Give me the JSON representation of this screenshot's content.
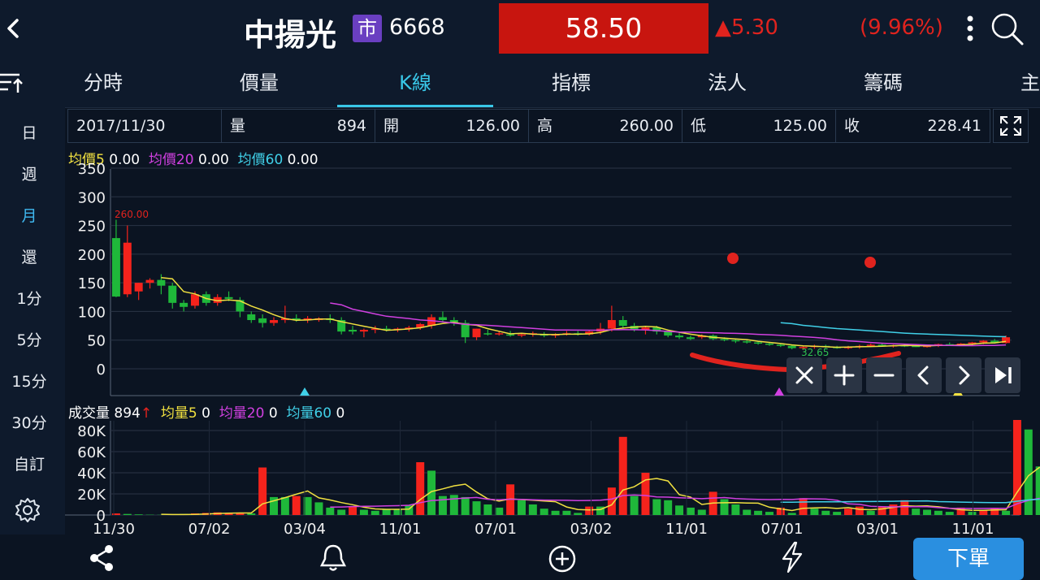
{
  "header": {
    "back_icon": "chevron-left-icon",
    "stock_name": "中揚光",
    "market_badge": "市",
    "stock_code": "6668",
    "price": "58.50",
    "change": "▲5.30",
    "change_pct": "(9.96%)",
    "colors": {
      "up": "#e0231e",
      "price_bg": "#c8150f"
    }
  },
  "tabs": {
    "menu_icon": "sort-icon",
    "items": [
      "分時",
      "價量",
      "K線",
      "指標",
      "法人",
      "籌碼",
      "主"
    ],
    "active": "K線"
  },
  "sidebar": {
    "items": [
      "日",
      "週",
      "月",
      "還",
      "1分",
      "5分",
      "15分",
      "30分",
      "自訂"
    ],
    "active": "月",
    "settings_icon": "gear-icon"
  },
  "infobar": {
    "date": "2017/11/30",
    "volume_label": "量",
    "volume": "894",
    "open_label": "開",
    "open": "126.00",
    "high_label": "高",
    "high": "260.00",
    "low_label": "低",
    "low": "125.00",
    "close_label": "收",
    "close": "228.41"
  },
  "price_legend": {
    "ma5_label": "均價5",
    "ma5": "0.00",
    "ma20_label": "均價20",
    "ma20": "0.00",
    "ma60_label": "均價60",
    "ma60": "0.00"
  },
  "volume_legend": {
    "label": "成交量",
    "value": "894",
    "arrow": "↑",
    "ma5_label": "均量5",
    "ma5": "0",
    "ma20_label": "均量20",
    "ma20": "0",
    "ma60_label": "均量60",
    "ma60": "0"
  },
  "chart_data": {
    "type": "candlestick",
    "price_axis": {
      "ticks": [
        "350",
        "300",
        "250",
        "200",
        "150",
        "100",
        "50",
        "0"
      ],
      "ylim": [
        0,
        350
      ]
    },
    "volume_axis": {
      "ticks": [
        "80K",
        "60K",
        "40K",
        "20K",
        "0"
      ],
      "ylim": [
        0,
        85000
      ]
    },
    "x_labels": [
      "11/30",
      "07/02",
      "03/04",
      "11/01",
      "07/01",
      "03/02",
      "11/01",
      "07/01",
      "03/01",
      "11/01"
    ],
    "annotations": {
      "max_label": "260.00",
      "min_label": "32.65"
    },
    "candles": [
      [
        228,
        260,
        125,
        126
      ],
      [
        130,
        250,
        125,
        220
      ],
      [
        135,
        150,
        120,
        150
      ],
      [
        150,
        158,
        140,
        155
      ],
      [
        155,
        165,
        130,
        145
      ],
      [
        145,
        150,
        105,
        115
      ],
      [
        115,
        120,
        100,
        108
      ],
      [
        110,
        135,
        105,
        130
      ],
      [
        130,
        135,
        110,
        115
      ],
      [
        115,
        130,
        110,
        125
      ],
      [
        125,
        135,
        118,
        122
      ],
      [
        120,
        125,
        90,
        100
      ],
      [
        95,
        100,
        80,
        85
      ],
      [
        88,
        95,
        72,
        80
      ],
      [
        80,
        90,
        75,
        85
      ],
      [
        85,
        110,
        80,
        88
      ],
      [
        88,
        95,
        82,
        85
      ],
      [
        85,
        92,
        80,
        88
      ],
      [
        85,
        90,
        82,
        88
      ],
      [
        88,
        95,
        80,
        85
      ],
      [
        85,
        90,
        60,
        65
      ],
      [
        68,
        75,
        60,
        65
      ],
      [
        65,
        70,
        55,
        68
      ],
      [
        68,
        75,
        62,
        70
      ],
      [
        70,
        75,
        65,
        68
      ],
      [
        68,
        72,
        64,
        70
      ],
      [
        70,
        75,
        65,
        72
      ],
      [
        72,
        80,
        68,
        78
      ],
      [
        75,
        95,
        70,
        90
      ],
      [
        90,
        100,
        82,
        85
      ],
      [
        85,
        90,
        75,
        80
      ],
      [
        80,
        85,
        45,
        55
      ],
      [
        55,
        70,
        50,
        70
      ],
      [
        62,
        68,
        58,
        60
      ],
      [
        62,
        66,
        58,
        62
      ],
      [
        60,
        66,
        56,
        58
      ],
      [
        58,
        62,
        55,
        60
      ],
      [
        60,
        65,
        56,
        62
      ],
      [
        60,
        64,
        55,
        58
      ],
      [
        58,
        62,
        54,
        60
      ],
      [
        60,
        66,
        58,
        62
      ],
      [
        62,
        66,
        58,
        60
      ],
      [
        60,
        68,
        58,
        65
      ],
      [
        65,
        80,
        60,
        70
      ],
      [
        70,
        110,
        65,
        85
      ],
      [
        85,
        92,
        70,
        75
      ],
      [
        75,
        80,
        65,
        68
      ],
      [
        68,
        75,
        60,
        72
      ],
      [
        72,
        75,
        60,
        65
      ],
      [
        65,
        68,
        55,
        58
      ],
      [
        58,
        62,
        52,
        55
      ],
      [
        55,
        58,
        50,
        52
      ],
      [
        55,
        60,
        52,
        58
      ],
      [
        58,
        60,
        50,
        52
      ],
      [
        52,
        55,
        48,
        50
      ],
      [
        50,
        52,
        45,
        48
      ],
      [
        48,
        50,
        44,
        46
      ],
      [
        46,
        48,
        42,
        44
      ],
      [
        44,
        46,
        40,
        42
      ],
      [
        42,
        44,
        38,
        40
      ],
      [
        40,
        42,
        34,
        36
      ],
      [
        36,
        40,
        33,
        38
      ],
      [
        38,
        42,
        35,
        40
      ],
      [
        40,
        42,
        36,
        38
      ],
      [
        38,
        40,
        35,
        36
      ],
      [
        36,
        40,
        34,
        38
      ],
      [
        38,
        42,
        35,
        40
      ],
      [
        40,
        44,
        38,
        42
      ],
      [
        42,
        44,
        39,
        40
      ],
      [
        40,
        42,
        37,
        41
      ],
      [
        41,
        43,
        38,
        40
      ],
      [
        40,
        42,
        38,
        39
      ],
      [
        39,
        41,
        37,
        40
      ],
      [
        40,
        44,
        38,
        43
      ],
      [
        43,
        46,
        40,
        42
      ],
      [
        42,
        45,
        40,
        44
      ],
      [
        44,
        47,
        41,
        46
      ],
      [
        46,
        50,
        43,
        49
      ],
      [
        49,
        52,
        44,
        45
      ],
      [
        45,
        58,
        44,
        55
      ]
    ],
    "volumes": [
      1500,
      1000,
      600,
      300,
      200,
      200,
      1000,
      1500,
      2000,
      2500,
      2000,
      1800,
      1500,
      45000,
      17000,
      17000,
      18000,
      17000,
      12000,
      7000,
      5000,
      8000,
      5000,
      4000,
      5000,
      5000,
      9000,
      50000,
      42000,
      18000,
      19000,
      17000,
      13000,
      10000,
      7000,
      29000,
      14000,
      10000,
      6000,
      4000,
      4000,
      2000,
      8000,
      8000,
      26000,
      74000,
      18000,
      40000,
      15000,
      14000,
      9000,
      7000,
      5000,
      22000,
      15000,
      10000,
      5000,
      4000,
      3000,
      7000,
      2000,
      16000,
      6000,
      4000,
      3000,
      6000,
      8000,
      4000,
      8000,
      10000,
      14000,
      6000,
      5000,
      4000,
      3000,
      7000,
      3000,
      5000,
      6000,
      4000,
      90000,
      81000,
      46000
    ],
    "vol_up": [
      true,
      false,
      false,
      false,
      false,
      false,
      false,
      true,
      true,
      true,
      true,
      true,
      false,
      true,
      false,
      false,
      true,
      false,
      false,
      false,
      false,
      true,
      false,
      false,
      false,
      false,
      false,
      true,
      false,
      false,
      false,
      false,
      false,
      false,
      false,
      true,
      false,
      false,
      false,
      false,
      false,
      false,
      true,
      false,
      true,
      true,
      false,
      true,
      false,
      false,
      false,
      false,
      false,
      true,
      false,
      false,
      false,
      false,
      false,
      true,
      false,
      true,
      false,
      false,
      false,
      true,
      true,
      false,
      true,
      true,
      true,
      false,
      false,
      false,
      false,
      true,
      false,
      true,
      true,
      false,
      true,
      false,
      false
    ],
    "colors": {
      "up": "#f5231c",
      "down": "#1fb83a",
      "ma5": "#f0e040",
      "ma20": "#d040e0",
      "ma60": "#40d0e8"
    }
  },
  "controls": {
    "icons": [
      "close-icon",
      "zoom-in-icon",
      "zoom-out-icon",
      "scroll-left-icon",
      "scroll-right-icon",
      "jump-end-icon"
    ]
  },
  "bottom_bar": {
    "icons": [
      "share-icon",
      "bell-icon",
      "add-circle-icon",
      "flash-icon"
    ],
    "order_label": "下單"
  }
}
